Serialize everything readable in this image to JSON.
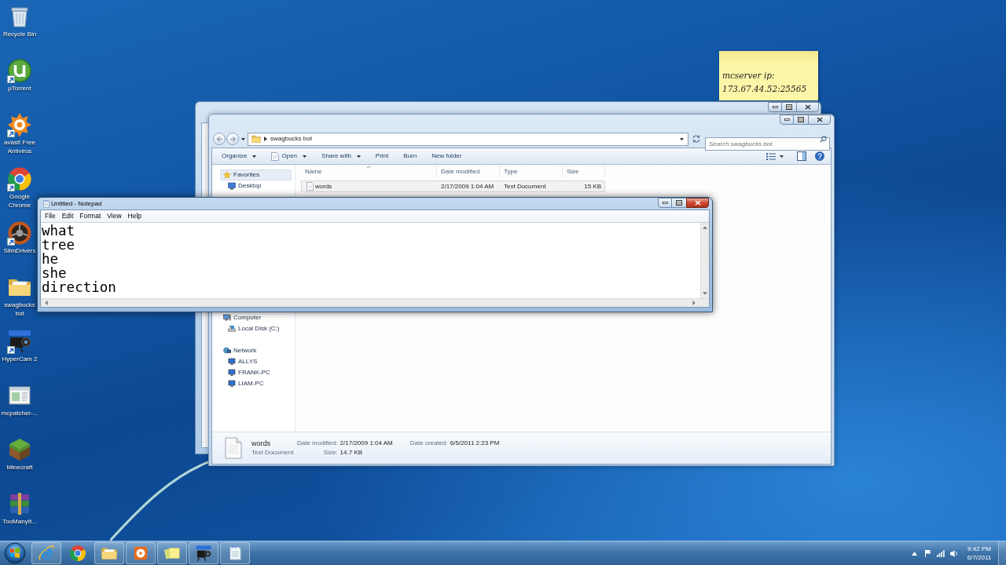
{
  "desktop_icons": [
    {
      "label": "Recycle Bin",
      "kind": "bin",
      "shortcut": false
    },
    {
      "label": "µTorrent",
      "kind": "torrent",
      "shortcut": true
    },
    {
      "label": "avast! Free Antivirus",
      "kind": "avast",
      "shortcut": true
    },
    {
      "label": "Google Chrome",
      "kind": "chrome",
      "shortcut": true
    },
    {
      "label": "SlimDrivers",
      "kind": "wheel",
      "shortcut": true
    },
    {
      "label": "swagbucks bot",
      "kind": "folder",
      "shortcut": false
    },
    {
      "label": "HyperCam 2",
      "kind": "camera",
      "shortcut": true
    },
    {
      "label": "mcpatcher-...",
      "kind": "window",
      "shortcut": false
    },
    {
      "label": "Minecraft",
      "kind": "block",
      "shortcut": false
    },
    {
      "label": "TooManyIt...",
      "kind": "books",
      "shortcut": false
    }
  ],
  "sticky_note": {
    "lines": [
      "mcserver ip:",
      "173.67.44.52:25565"
    ]
  },
  "explorer": {
    "active": false,
    "address": {
      "path": [
        "swagbucks bot"
      ]
    },
    "search": {
      "placeholder": "Search swagbucks bot"
    },
    "toolbar": [
      {
        "label": "Organize",
        "menu": true,
        "icon": false
      },
      {
        "label": "Open",
        "menu": true,
        "icon": true
      },
      {
        "label": "Share with",
        "menu": true,
        "icon": false
      },
      {
        "label": "Print",
        "menu": false,
        "icon": false
      },
      {
        "label": "Burn",
        "menu": false,
        "icon": false
      },
      {
        "label": "New folder",
        "menu": false,
        "icon": false
      }
    ],
    "nav": [
      {
        "label": "Favorites",
        "kind": "star",
        "highlighted": true,
        "children": [
          {
            "label": "Desktop",
            "kind": "desktop",
            "highlighted": false
          }
        ]
      },
      {
        "label": "Computer",
        "kind": "computer",
        "highlighted": false,
        "children": [
          {
            "label": "Local Disk (C:)",
            "kind": "disk",
            "highlighted": false
          }
        ]
      },
      {
        "label": "Network",
        "kind": "network",
        "highlighted": false,
        "children": [
          {
            "label": "ALLYS",
            "kind": "pc",
            "highlighted": false
          },
          {
            "label": "FRANK-PC",
            "kind": "pc",
            "highlighted": false
          },
          {
            "label": "LIAM-PC",
            "kind": "pc",
            "highlighted": false
          }
        ]
      }
    ],
    "columns": [
      {
        "label": "Name",
        "sorted": true
      },
      {
        "label": "Date modified",
        "sorted": false
      },
      {
        "label": "Type",
        "sorted": false
      },
      {
        "label": "Size",
        "sorted": false
      }
    ],
    "rows": [
      {
        "name": "words",
        "date_modified": "2/17/2009 1:04 AM",
        "type": "Text Document",
        "size": "15 KB",
        "selected": true
      }
    ],
    "details": {
      "name": "words",
      "type": "Text Document",
      "fields": [
        {
          "label": "Date modified:",
          "value": "2/17/2009 1:04 AM"
        },
        {
          "label": "Size:",
          "value": "14.7 KB"
        },
        {
          "label": "Date created:",
          "value": "6/5/2011 2:23 PM"
        }
      ]
    }
  },
  "notepad": {
    "title": "Untitled - Notepad",
    "active": true,
    "menu": [
      "File",
      "Edit",
      "Format",
      "View",
      "Help"
    ],
    "lines": [
      "what",
      "tree",
      "he",
      "she",
      "direction"
    ]
  },
  "taskbar": {
    "apps": [
      {
        "kind": "e",
        "running": true
      },
      {
        "kind": "chrome",
        "running": false
      },
      {
        "kind": "folder",
        "running": true
      },
      {
        "kind": "play",
        "running": true
      },
      {
        "kind": "notes",
        "running": true
      },
      {
        "kind": "camera",
        "running": true
      },
      {
        "kind": "notepad",
        "running": true
      }
    ],
    "clock": {
      "time": "9:42 PM",
      "date": "6/7/2011"
    }
  }
}
